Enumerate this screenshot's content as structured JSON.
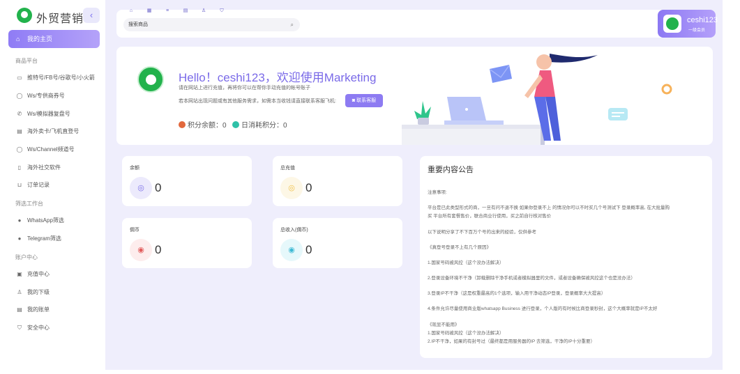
{
  "brand": {
    "name": "外贸营销",
    "collapse_icon": "chevron-left-icon"
  },
  "nav": {
    "active": "我的主页",
    "sections": [
      {
        "title": "商品平台",
        "items": [
          "推特号/FB号/谷歌号/小火箭",
          "Ws/专供商券号",
          "Ws/模拟器复盘号",
          "海外卖卡/飞机直登号",
          "Ws/Channel频道号",
          "海外社交软件",
          "订单记录"
        ]
      },
      {
        "title": "筛选工作台",
        "items": [
          "WhatsApp筛选",
          "Telegram筛选"
        ]
      },
      {
        "title": "账户中心",
        "items": [
          "充值中心",
          "我的下级",
          "我的账单",
          "安全中心"
        ]
      }
    ]
  },
  "topbar": {
    "search_placeholder": "搜索商品",
    "user": {
      "name": "ceshi123",
      "role": "一级会员"
    }
  },
  "welcome": {
    "title": "Hello！ceshi123，欢迎使用Marketing",
    "line1": "请在网站上进行充值，再将你可以在帮你手动充值的帐号账子",
    "line2": "若本网站出现问题或有其他服务需求，如需本当收钱请直接联系客服飞机:",
    "contact_btn": "联系客服",
    "balance_label": "积分余额：",
    "balance_value": "0",
    "today_label": "日消耗积分：",
    "today_value": "0"
  },
  "cards": [
    {
      "label": "余额",
      "value": "0",
      "icon": "coin-icon",
      "color": "#7c6fe8",
      "bg": "#eceafc"
    },
    {
      "label": "总充值",
      "value": "0",
      "icon": "coin-icon",
      "color": "#f1c24a",
      "bg": "#fdf7e6"
    },
    {
      "label": "佣币",
      "value": "0",
      "icon": "target-icon",
      "color": "#e25b5b",
      "bg": "#fdeded"
    },
    {
      "label": "总收入(佣币)",
      "value": "0",
      "icon": "target-icon",
      "color": "#3cb9d4",
      "bg": "#e6f8fb"
    }
  ],
  "notice": {
    "title": "重要内容公告",
    "lines": [
      "注意事项:",
      "平台是已此类型形式的商，一旦有问不退不换 如果你登录不上 的情况你可以不时买几个号测试下 登录概率高, 在大批量购",
      "买 平台所有套餐售价，联合商业行使用，买之前自行核对售价",
      "以下说明分享了不下百万个号的出来的经验，仅供参考",
      "《真登号登录不上有几个原因》",
      "1.国家号码被风控（这个没办法解决）",
      "2.登录设备环境不干净（卸载删除干净手机或者模拟器里的文件，或者设备确保被风控这个也是没办法）",
      "3.登录IP不干净（这是权重最高的1个选项，输入用干净动态IP登录，登录概率大大提高）",
      "4.条件允许尽量使用商业版whatsapp Business 进行登录，个人版的有时候比商登录秒封，这个大概率就是IP不太好",
      "《现显不能用》",
      "1.国家号码被风控（这个没办法解决）",
      "2.IP不干净，如果的有封号过（最终都是用服务器的IP 去筛选，干净的IP十分重要）"
    ]
  },
  "colors": {
    "accent": "#8d7bf2",
    "main_bg": "#efeefc",
    "brand_green": "#22b24c"
  }
}
